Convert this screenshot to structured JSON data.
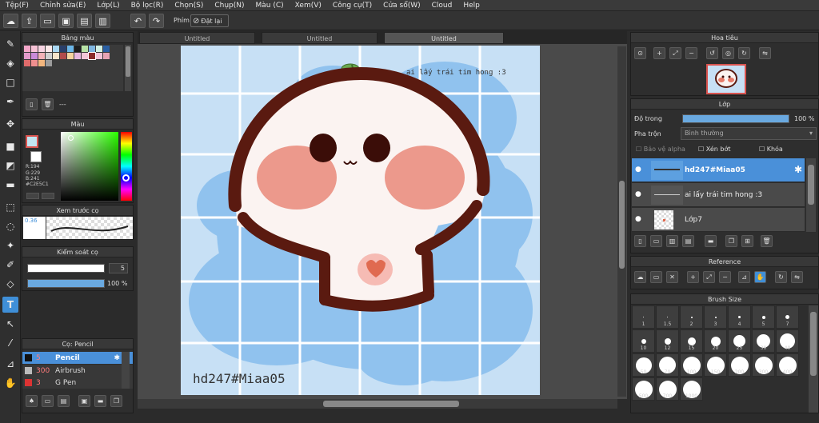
{
  "menu": [
    "Tệp(F)",
    "Chỉnh sửa(E)",
    "Lớp(L)",
    "Bộ lọc(R)",
    "Chọn(S)",
    "Chụp(N)",
    "Màu (C)",
    "Xem(V)",
    "Công cụ(T)",
    "Cửa sổ(W)",
    "Cloud",
    "Help"
  ],
  "toolbar": {
    "key_label": "Phím",
    "reset_label": "Đặt lại"
  },
  "panels": {
    "palette_title": "Bảng màu",
    "color_title": "Màu",
    "brush_preview_title": "Xem trước cọ",
    "brush_control_title": "Kiểm soát cọ",
    "brush_list_title": "Cọ: Pencil",
    "navigator_title": "Hoa tiêu",
    "layer_title": "Lớp",
    "reference_title": "Reference",
    "brush_size_title": "Brush Size"
  },
  "palette_footer": "---",
  "color": {
    "r": "R:194",
    "g": "G:229",
    "b": "B:241",
    "hex": "#C2E5C1",
    "current": "#c2e5f1"
  },
  "brush_preview": {
    "size": "0.36"
  },
  "brush_control": {
    "size": "5",
    "opacity": "100 %"
  },
  "brushes": [
    {
      "size": "5",
      "name": "Pencil",
      "selected": true
    },
    {
      "size": "300",
      "name": "Airbrush",
      "selected": false
    },
    {
      "size": "3",
      "name": "G Pen",
      "selected": false
    }
  ],
  "tabs": [
    "Untitled",
    "Untitled",
    "Untitled"
  ],
  "canvas": {
    "title_text": "ai lấy trái tim hong :3",
    "signature": "hd247#Miaa05"
  },
  "layer_props": {
    "opacity_label": "Độ trong",
    "opacity_value": "100 %",
    "blend_label": "Pha trộn",
    "blend_value": "Bình thường",
    "alpha_label": "Bảo vệ alpha",
    "clip_label": "Xén bớt",
    "lock_label": "Khóa"
  },
  "layers": [
    {
      "name": "hd247#Miaa05",
      "selected": true
    },
    {
      "name": "ai lấy trái tim hong :3",
      "selected": false
    },
    {
      "name": "Lớp7",
      "selected": false
    }
  ],
  "brush_sizes": [
    "1",
    "1.5",
    "2",
    "3",
    "4",
    "5",
    "7",
    "10",
    "12",
    "15",
    "20",
    "25",
    "30",
    "40",
    "50",
    "70",
    "100",
    "150",
    "200",
    "300",
    "400",
    "500",
    "700",
    "1000"
  ],
  "colors": {
    "accent": "#3f8fd8",
    "chocolate": "#5a1a10",
    "blush": "#e77b6a",
    "paper": "#c7e0f5",
    "cloud": "#90c2ee",
    "leaf": "#6aa84f"
  }
}
